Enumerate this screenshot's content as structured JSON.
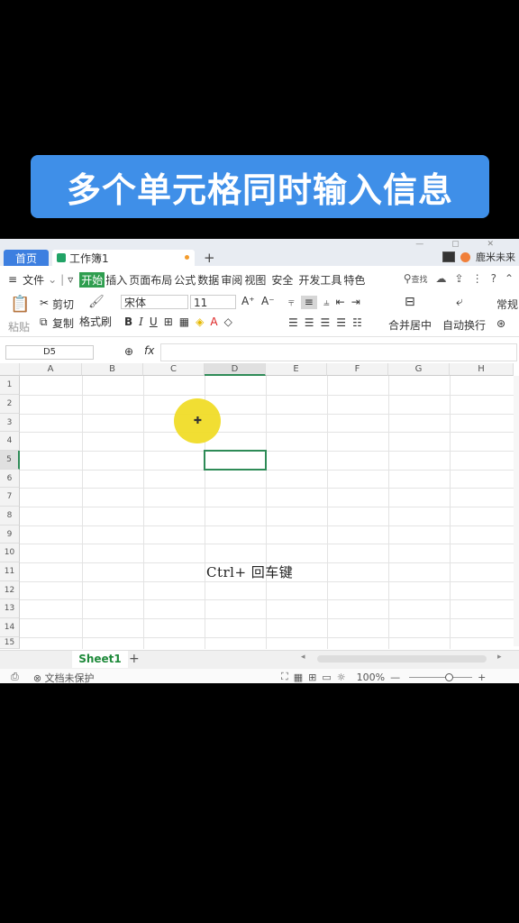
{
  "banner": {
    "title": "多个单元格同时输入信息"
  },
  "tabbar": {
    "home_tab": "首页",
    "workbook_tab": "工作簿1",
    "add_tab": "+",
    "user_name": "鹿米未来"
  },
  "menu": {
    "file": "文件",
    "items": [
      "开始",
      "插入",
      "页面布局",
      "公式",
      "数据",
      "审阅",
      "视图",
      "安全",
      "开发工具",
      "特色"
    ],
    "search": "查找",
    "help": "?"
  },
  "ribbon": {
    "paste": "粘贴",
    "cut": "剪切",
    "copy": "复制",
    "format_painter": "格式刷",
    "font_name": "宋体",
    "font_size": "11",
    "bold": "B",
    "italic": "I",
    "underline": "U",
    "merge_center": "合并居中",
    "auto_wrap": "自动换行",
    "number_format": "常规"
  },
  "formula_bar": {
    "cell_ref": "D5",
    "fx": "fx"
  },
  "grid": {
    "columns": [
      "A",
      "B",
      "C",
      "D",
      "E",
      "F",
      "G",
      "H"
    ],
    "rows": [
      "1",
      "2",
      "3",
      "4",
      "5",
      "6",
      "7",
      "8",
      "9",
      "10",
      "11",
      "12",
      "13",
      "14",
      "15"
    ],
    "selected_column": "D",
    "selected_row": "5"
  },
  "overlay": {
    "caption": "Ctrl+ 回车键"
  },
  "sheets": {
    "tab": "Sheet1",
    "add": "+"
  },
  "status": {
    "doc_protect": "文档未保护",
    "zoom": "100%",
    "minus": "—",
    "plus": "+"
  },
  "colors": {
    "banner": "#3f8fe8",
    "accent_green": "#2e8b57",
    "home_tab": "#3d7fe0",
    "cursor_highlight": "#f0dc28"
  }
}
